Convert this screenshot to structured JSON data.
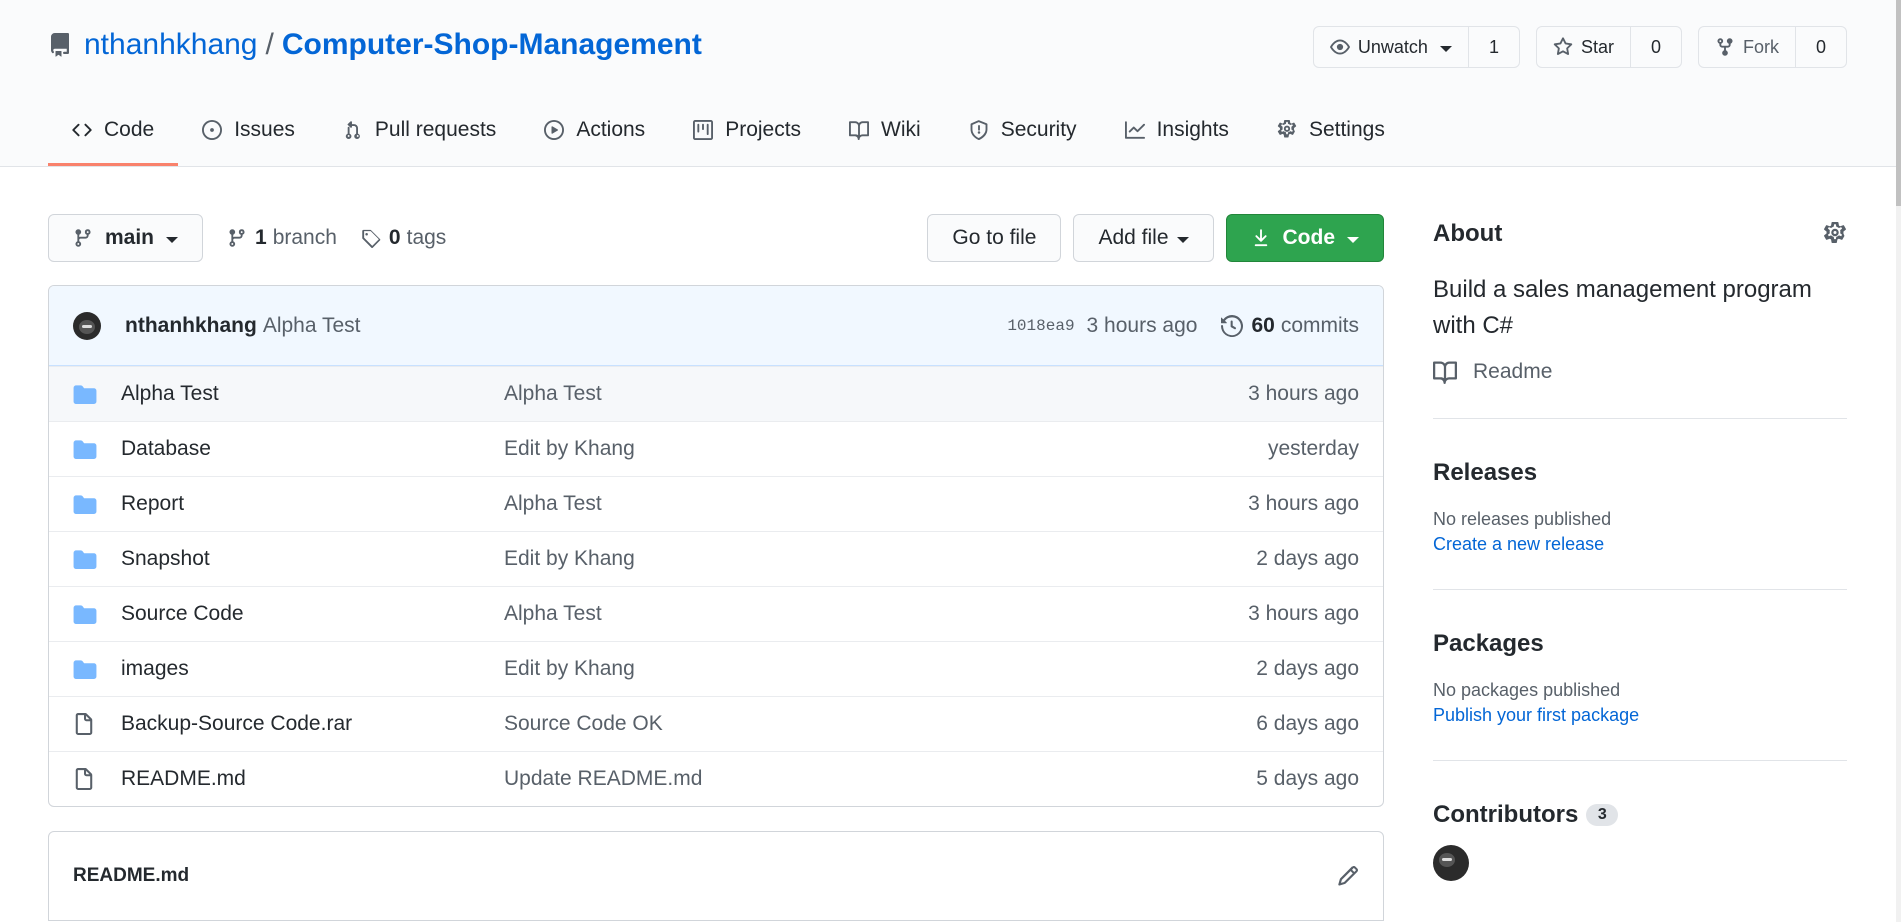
{
  "repo": {
    "owner": "nthanhkhang",
    "separator": "/",
    "name": "Computer-Shop-Management"
  },
  "actions": {
    "watch_label": "Unwatch",
    "watch_count": "1",
    "star_label": "Star",
    "star_count": "0",
    "fork_label": "Fork",
    "fork_count": "0"
  },
  "tabs": [
    {
      "label": "Code",
      "icon": "code-icon",
      "active": true
    },
    {
      "label": "Issues",
      "icon": "issue-icon"
    },
    {
      "label": "Pull requests",
      "icon": "pull-request-icon"
    },
    {
      "label": "Actions",
      "icon": "play-icon"
    },
    {
      "label": "Projects",
      "icon": "project-icon"
    },
    {
      "label": "Wiki",
      "icon": "book-icon"
    },
    {
      "label": "Security",
      "icon": "shield-icon"
    },
    {
      "label": "Insights",
      "icon": "graph-icon"
    },
    {
      "label": "Settings",
      "icon": "gear-icon"
    }
  ],
  "file_nav": {
    "branch": "main",
    "branch_count": "1",
    "branch_label": "branch",
    "tag_count": "0",
    "tag_label": "tags",
    "go_to_file": "Go to file",
    "add_file": "Add file",
    "code_button": "Code"
  },
  "latest_commit": {
    "author": "nthanhkhang",
    "message": "Alpha Test",
    "sha": "1018ea9",
    "age": "3 hours ago",
    "commit_count": "60",
    "commit_label": "commits"
  },
  "files": [
    {
      "type": "dir",
      "name": "Alpha Test",
      "message": "Alpha Test",
      "age": "3 hours ago"
    },
    {
      "type": "dir",
      "name": "Database",
      "message": "Edit by Khang",
      "age": "yesterday"
    },
    {
      "type": "dir",
      "name": "Report",
      "message": "Alpha Test",
      "age": "3 hours ago"
    },
    {
      "type": "dir",
      "name": "Snapshot",
      "message": "Edit by Khang",
      "age": "2 days ago"
    },
    {
      "type": "dir",
      "name": "Source Code",
      "message": "Alpha Test",
      "age": "3 hours ago"
    },
    {
      "type": "dir",
      "name": "images",
      "message": "Edit by Khang",
      "age": "2 days ago"
    },
    {
      "type": "file",
      "name": "Backup-Source Code.rar",
      "message": "Source Code OK",
      "age": "6 days ago"
    },
    {
      "type": "file",
      "name": "README.md",
      "message": "Update README.md",
      "age": "5 days ago"
    }
  ],
  "readme": {
    "title": "README.md"
  },
  "sidebar": {
    "about_title": "About",
    "description": "Build a sales management program with C#",
    "readme_link": "Readme",
    "releases_title": "Releases",
    "releases_empty": "No releases published",
    "releases_link": "Create a new release",
    "packages_title": "Packages",
    "packages_empty": "No packages published",
    "packages_link": "Publish your first package",
    "contributors_title": "Contributors",
    "contributors_count": "3"
  },
  "colors": {
    "link": "#0366d6",
    "active_tab_underline": "#f9826c",
    "primary_button": "#2ea44f",
    "folder": "#79b8ff",
    "commit_bar": "#f1f8ff"
  }
}
